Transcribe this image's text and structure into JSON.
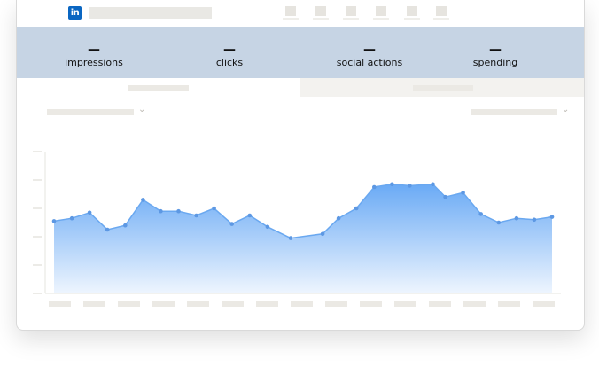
{
  "app": {
    "logo_text": "in",
    "brand_color": "#0a66c2"
  },
  "nav_icons": [
    "nav-icon-1",
    "nav-icon-2",
    "nav-icon-3",
    "nav-icon-4",
    "nav-icon-5",
    "nav-icon-6"
  ],
  "metrics": [
    {
      "value": "—",
      "label": "impressions"
    },
    {
      "value": "—",
      "label": "clicks"
    },
    {
      "value": "—",
      "label": "social actions"
    },
    {
      "value": "—",
      "label": "spending"
    }
  ],
  "tabs": {
    "active_index": 0
  },
  "colors": {
    "header_band": "#c6d4e4",
    "line": "#6aa8f0",
    "point": "#5d98e3",
    "fill_top": "#6aaaf5",
    "fill_bottom": "#eef5fe"
  },
  "chart_data": {
    "type": "area",
    "title": "",
    "xlabel": "",
    "ylabel": "",
    "ylim": [
      0,
      100
    ],
    "grid": false,
    "legend": "none",
    "x": [
      0,
      1,
      2,
      3,
      4,
      5,
      6,
      7,
      8,
      9,
      10,
      11,
      12,
      13,
      14,
      15,
      16,
      17,
      18,
      19,
      20,
      21,
      22,
      23,
      24,
      25,
      26,
      27,
      28,
      29
    ],
    "values": [
      51,
      53,
      57,
      45,
      48,
      66,
      58,
      58,
      55,
      60,
      49,
      55,
      47,
      39,
      42,
      53,
      60,
      75,
      77,
      76,
      77,
      68,
      71,
      56,
      50,
      53,
      52,
      54
    ],
    "x_positions": [
      0,
      1,
      2,
      3,
      4,
      5,
      6,
      7,
      8,
      9,
      10,
      11,
      12,
      13.3,
      15.1,
      16,
      17,
      18,
      19,
      20,
      21.3,
      22,
      23,
      24,
      25,
      26,
      27,
      28
    ]
  }
}
